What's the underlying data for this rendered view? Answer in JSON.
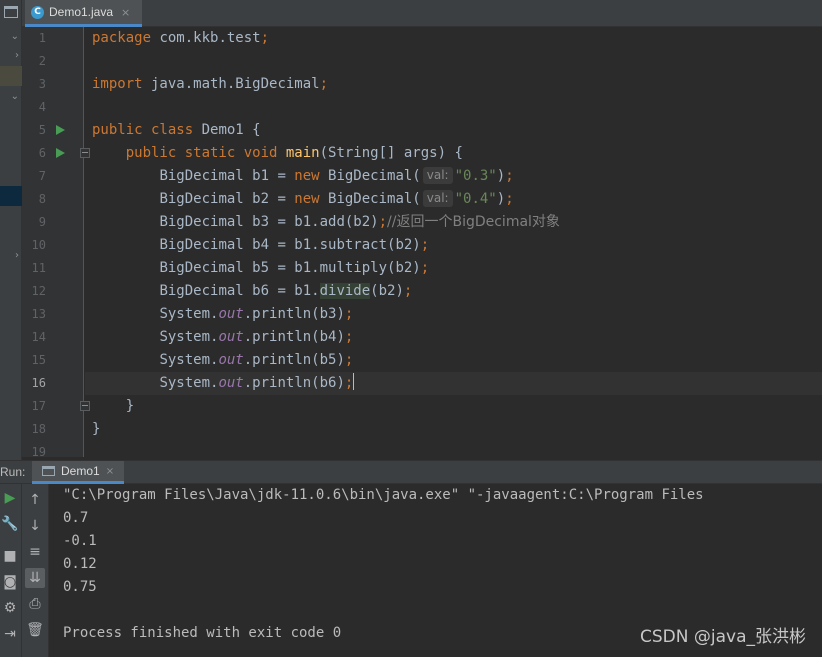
{
  "editor": {
    "tab": {
      "label": "Demo1.java",
      "close": "×"
    },
    "line_numbers": [
      "1",
      "2",
      "3",
      "4",
      "5",
      "6",
      "7",
      "8",
      "9",
      "10",
      "11",
      "12",
      "13",
      "14",
      "15",
      "16",
      "17",
      "18",
      "19"
    ],
    "current_line": 16,
    "code": {
      "l1": {
        "kw": "package",
        "rest": " com.kkb.test",
        "semi": ";"
      },
      "l3": {
        "kw": "import",
        "rest": " java.math.BigDecimal",
        "semi": ";"
      },
      "l5": {
        "kw": "public class",
        "rest": " Demo1 {"
      },
      "l6": {
        "kw": "public static void",
        "method": "main",
        "rest": "(String[] args) {"
      },
      "l7": {
        "pre": "BigDecimal b1 = ",
        "kw": "new",
        "post": " BigDecimal(",
        "hint": "val:",
        "str": "\"0.3\"",
        "end": ")",
        "semi": ";"
      },
      "l8": {
        "pre": "BigDecimal b2 = ",
        "kw": "new",
        "post": " BigDecimal(",
        "hint": "val:",
        "str": "\"0.4\"",
        "end": ")",
        "semi": ";"
      },
      "l9": {
        "code": "BigDecimal b3 = b1.add(b2)",
        "semi": ";",
        "comment": "//返回一个BigDecimal对象"
      },
      "l10": {
        "code": "BigDecimal b4 = b1.subtract(b2)",
        "semi": ";"
      },
      "l11": {
        "code": "BigDecimal b5 = b1.multiply(b2)",
        "semi": ";"
      },
      "l12": {
        "pre": "BigDecimal b6 = b1.",
        "hl": "divide",
        "post": "(b2)",
        "semi": ";"
      },
      "l13": {
        "pre": "System.",
        "field": "out",
        "post": ".println(b3)",
        "semi": ";"
      },
      "l14": {
        "pre": "System.",
        "field": "out",
        "post": ".println(b4)",
        "semi": ";"
      },
      "l15": {
        "pre": "System.",
        "field": "out",
        "post": ".println(b5)",
        "semi": ";"
      },
      "l16": {
        "pre": "System.",
        "field": "out",
        "post": ".println(b6)",
        "semi": ";"
      },
      "l17": {
        "code": "}"
      },
      "l18": {
        "code": "}"
      }
    }
  },
  "run": {
    "label": "Run:",
    "tab": {
      "label": "Demo1",
      "close": "×"
    },
    "console": [
      "\"C:\\Program Files\\Java\\jdk-11.0.6\\bin\\java.exe\" \"-javaagent:C:\\Program Files",
      "0.7",
      "-0.1",
      "0.12",
      "0.75",
      "",
      "Process finished with exit code 0"
    ]
  },
  "watermark": "CSDN @java_张洪彬",
  "colors": {
    "background": "#2b2b2b",
    "keyword": "#cc7832",
    "string": "#6a8759",
    "field": "#9876aa",
    "method": "#ffc66d",
    "accent": "#4a88c7"
  }
}
